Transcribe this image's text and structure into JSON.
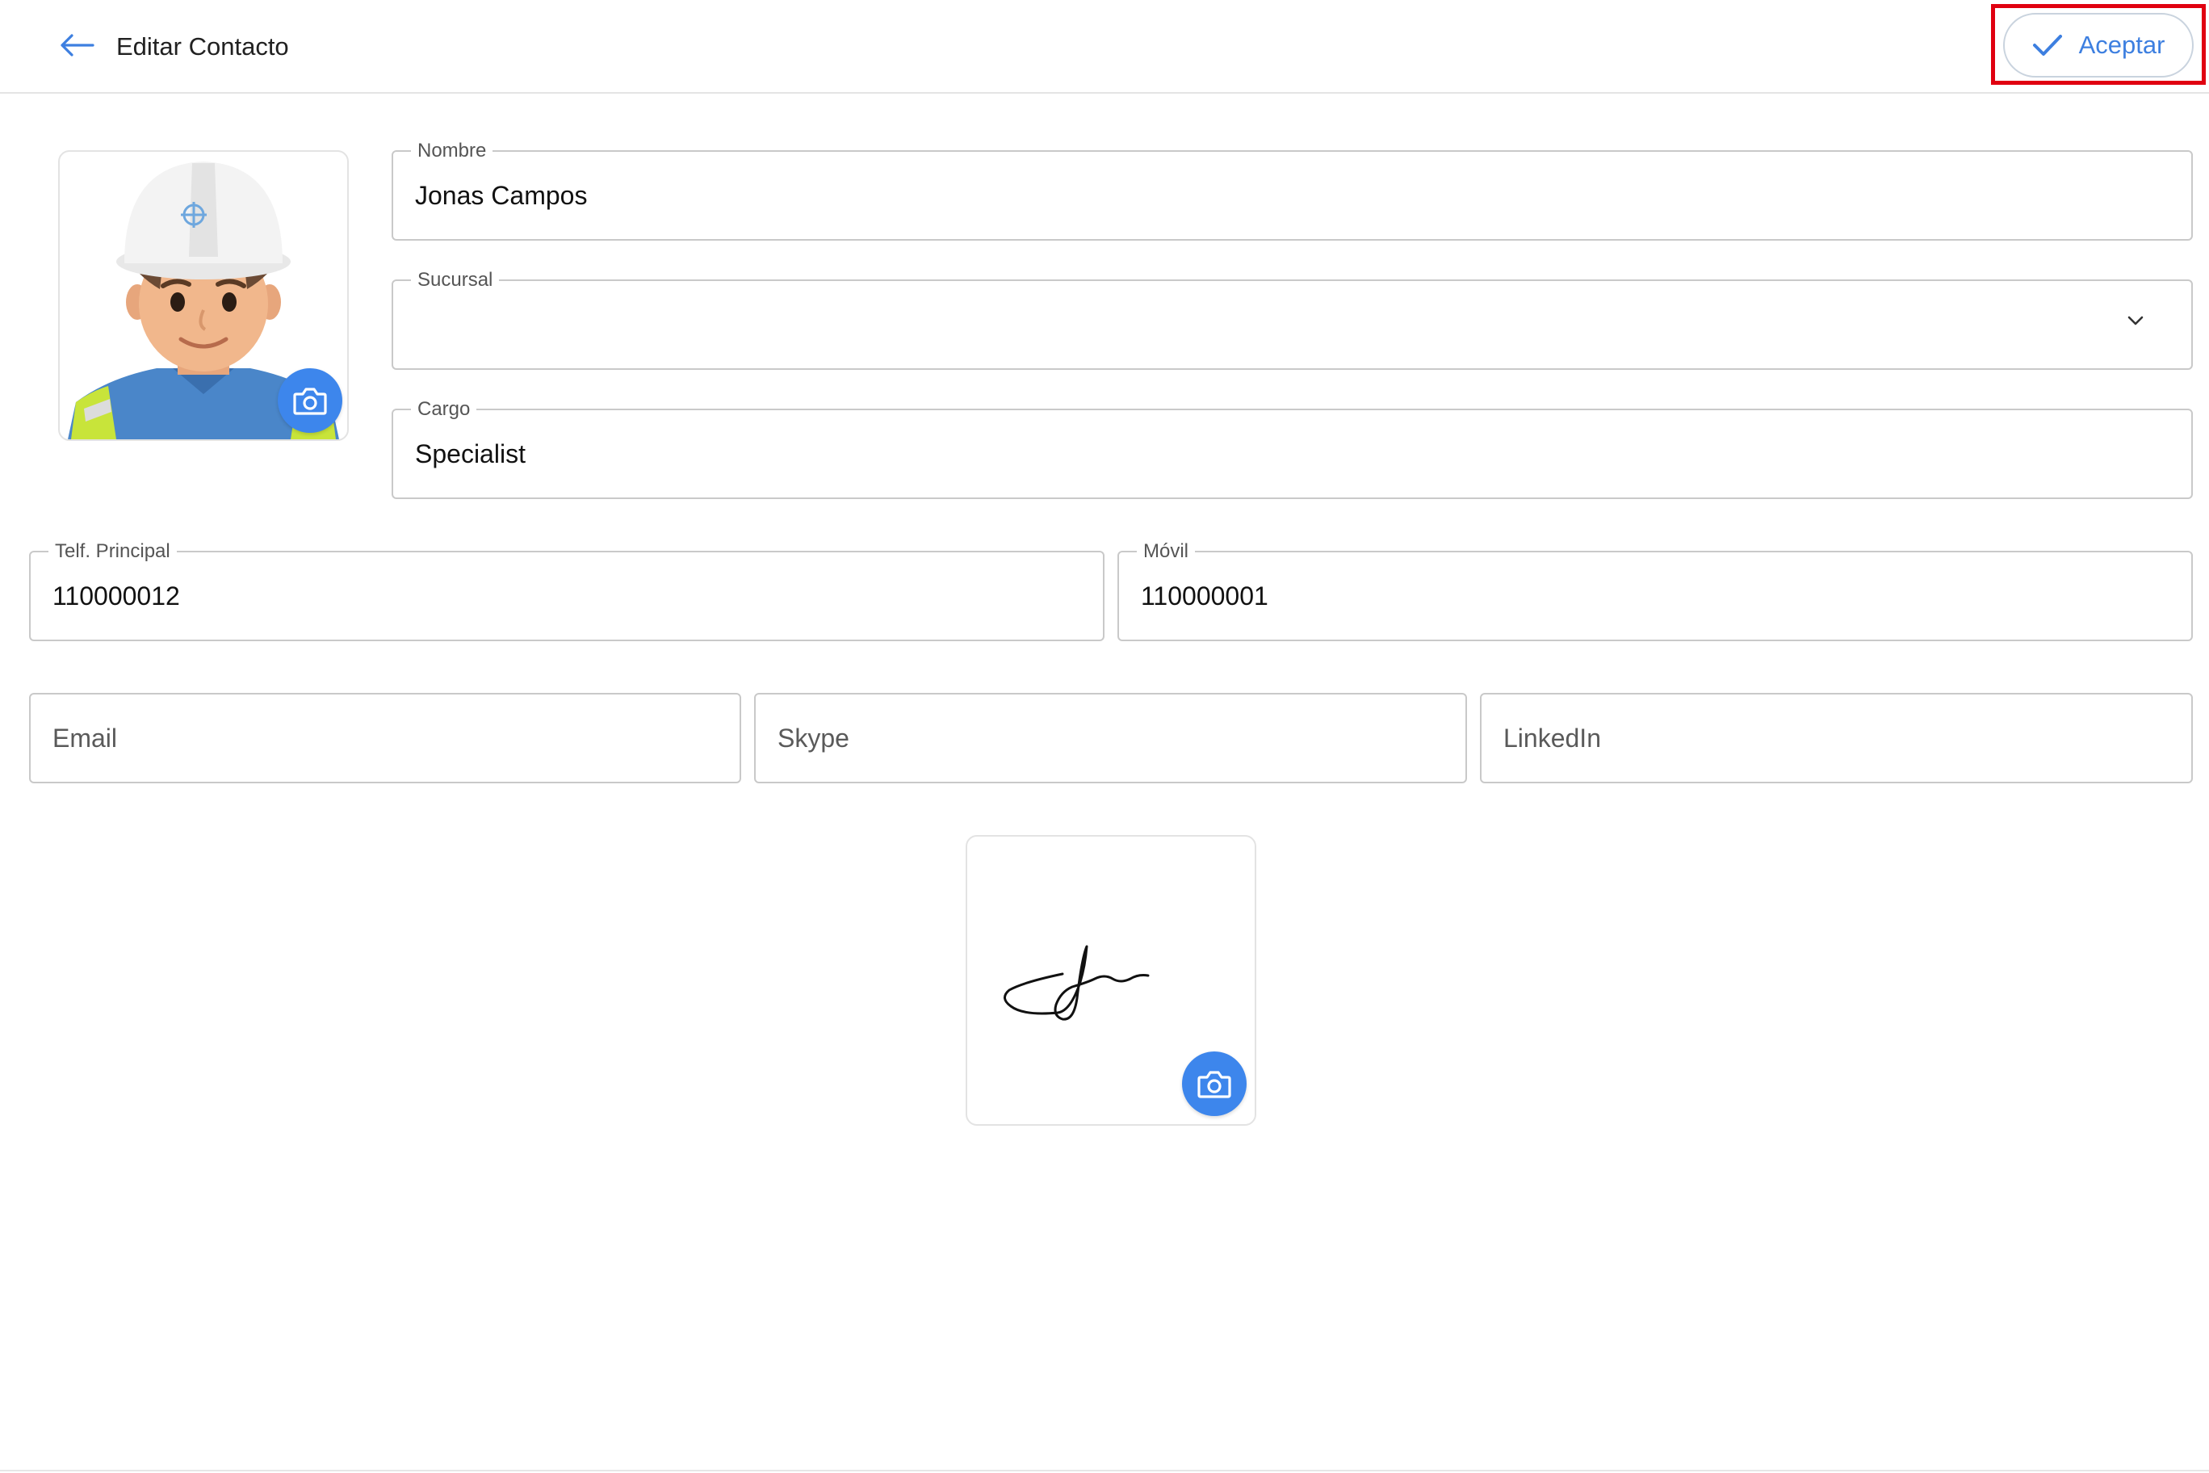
{
  "header": {
    "title": "Editar Contacto",
    "accept_label": "Aceptar",
    "accent_color": "#3d7fe0",
    "highlight_color": "#e00010"
  },
  "avatar": {
    "icon": "camera-icon"
  },
  "fields": {
    "nombre": {
      "label": "Nombre",
      "value": "Jonas Campos"
    },
    "sucursal": {
      "label": "Sucursal",
      "value": ""
    },
    "cargo": {
      "label": "Cargo",
      "value": "Specialist"
    },
    "telf_principal": {
      "label": "Telf. Principal",
      "value": "110000012"
    },
    "movil": {
      "label": "Móvil",
      "value": "110000001"
    },
    "email": {
      "placeholder": "Email"
    },
    "skype": {
      "placeholder": "Skype"
    },
    "linkedin": {
      "placeholder": "LinkedIn"
    }
  },
  "signature": {
    "icon": "camera-icon"
  }
}
